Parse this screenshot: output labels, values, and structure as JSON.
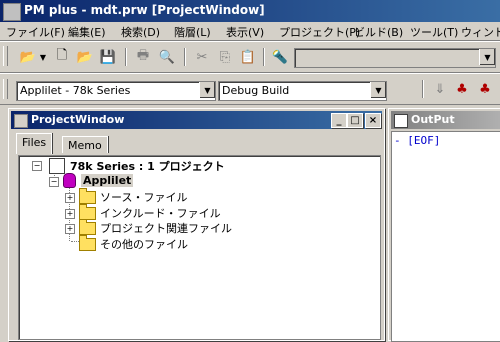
{
  "app": {
    "title": "PM plus - mdt.prw [ProjectWindow]"
  },
  "menu": [
    {
      "label": "ファイル(F)"
    },
    {
      "label": "編集(E)"
    },
    {
      "label": "検索(D)"
    },
    {
      "label": "階層(L)"
    },
    {
      "label": "表示(V)"
    },
    {
      "label": "プロジェクト(P)"
    },
    {
      "label": "ビルド(B)"
    },
    {
      "label": "ツール(T)"
    },
    {
      "label": "ウィンドウ"
    }
  ],
  "toolbar2": {
    "project_select": "Applilet - 78k Series",
    "build_select": "Debug Build"
  },
  "project_window": {
    "title": "ProjectWindow",
    "tabs": [
      {
        "label": "Files"
      },
      {
        "label": "Memo"
      }
    ],
    "tree": {
      "root": "78k Series : 1 プロジェクト",
      "project": "Applilet",
      "folders": [
        {
          "label": "ソース・ファイル"
        },
        {
          "label": "インクルード・ファイル"
        },
        {
          "label": "プロジェクト関連ファイル"
        },
        {
          "label": "その他のファイル"
        }
      ]
    }
  },
  "output_window": {
    "title": "OutPut",
    "text": "- [EOF]"
  },
  "colors": {
    "titlebar_active": "#0a246a",
    "titlebar_inactive": "#808080",
    "face": "#d4d0c8"
  }
}
